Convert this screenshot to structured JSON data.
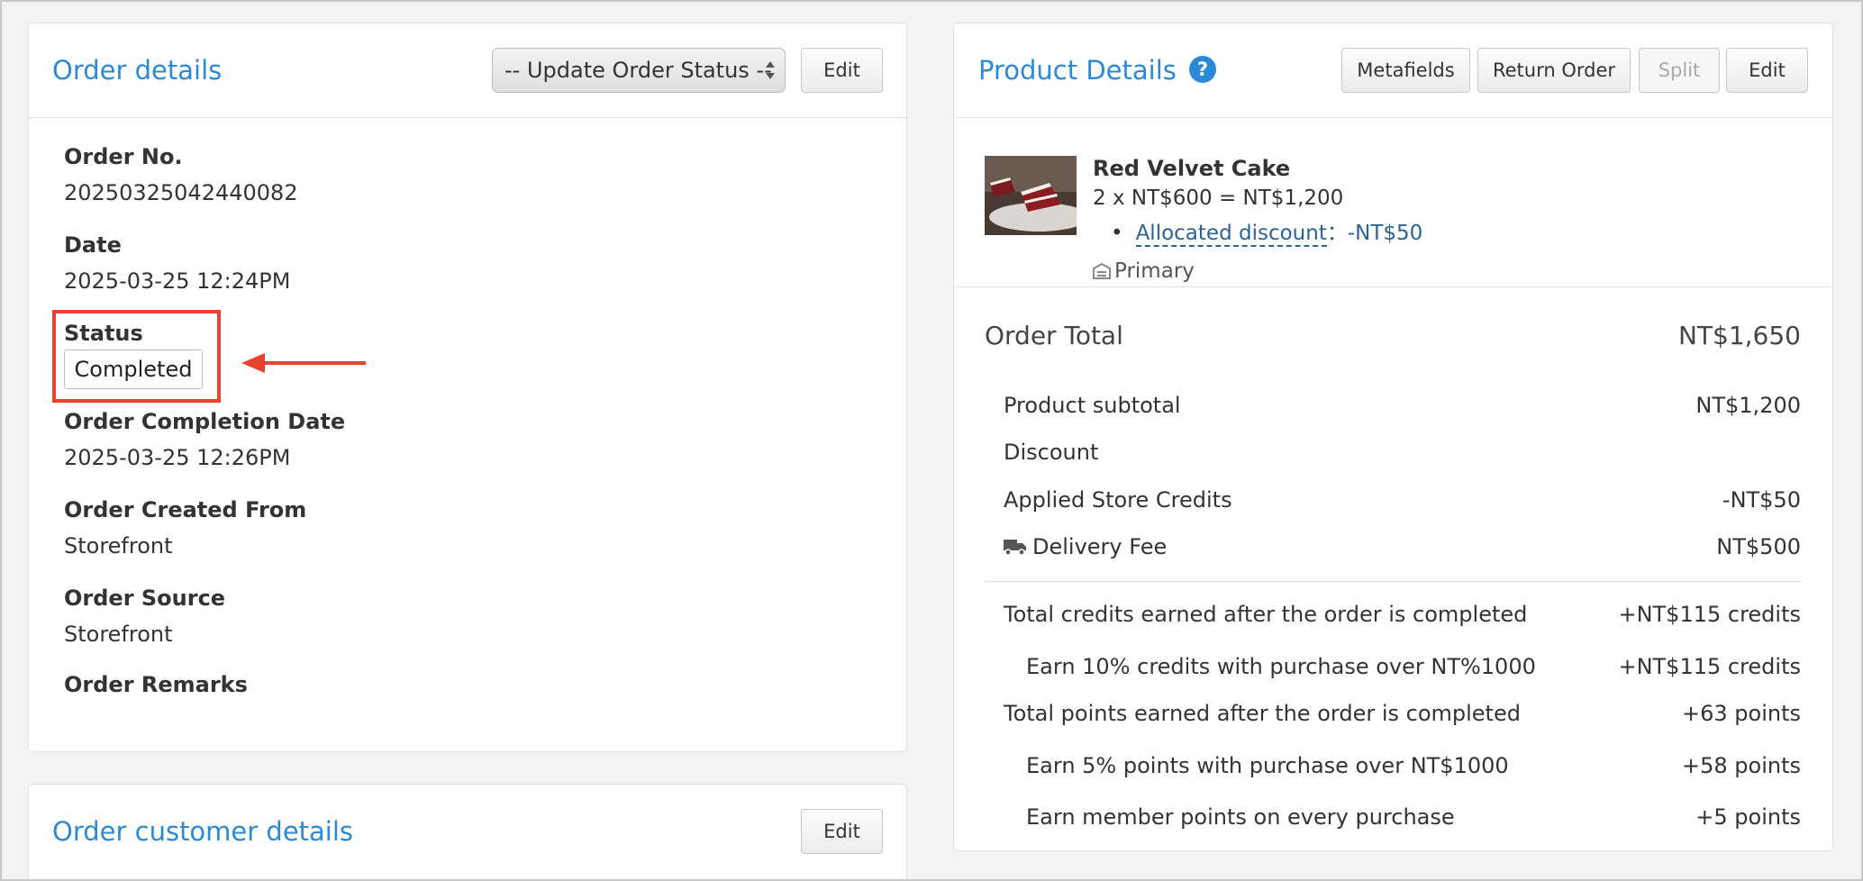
{
  "order_details": {
    "title": "Order details",
    "status_select": "-- Update Order Status --",
    "edit_label": "Edit",
    "fields": {
      "order_no_label": "Order No.",
      "order_no_value": "20250325042440082",
      "date_label": "Date",
      "date_value": "2025-03-25 12:24PM",
      "status_label": "Status",
      "status_value": "Completed",
      "completion_label": "Order Completion Date",
      "completion_value": "2025-03-25 12:26PM",
      "created_from_label": "Order Created From",
      "created_from_value": "Storefront",
      "source_label": "Order Source",
      "source_value": "Storefront",
      "remarks_label": "Order Remarks"
    }
  },
  "customer_details": {
    "title": "Order customer details",
    "edit_label": "Edit"
  },
  "product_details": {
    "title": "Product Details",
    "help_icon": "question-circle-icon",
    "buttons": {
      "metafields": "Metafields",
      "return_order": "Return Order",
      "split": "Split",
      "edit": "Edit"
    },
    "item": {
      "name": "Red Velvet Cake",
      "price_line": "2 x NT$600 = NT$1,200",
      "discount_link": "Allocated discount",
      "discount_amount": "：-NT$50",
      "location": "Primary"
    },
    "order_total_label": "Order Total",
    "order_total_value": "NT$1,650",
    "summary": {
      "subtotal_label": "Product subtotal",
      "subtotal_value": "NT$1,200",
      "discount_label": "Discount",
      "credits_label": "Applied Store Credits",
      "credits_value": "-NT$50",
      "delivery_label": "Delivery Fee",
      "delivery_value": "NT$500"
    },
    "rewards": {
      "total_credits_label": "Total credits earned after the order is completed",
      "total_credits_value": "+NT$115 credits",
      "credits_rule_label": "Earn 10% credits with purchase over NT%1000",
      "credits_rule_value": "+NT$115 credits",
      "total_points_label": "Total points earned after the order is completed",
      "total_points_value": "+63 points",
      "points_rule_label": "Earn 5% points with purchase over NT$1000",
      "points_rule_value": "+58 points",
      "member_points_label": "Earn member points on every purchase",
      "member_points_value": "+5 points"
    }
  },
  "colors": {
    "accent": "#2b8ad8",
    "highlight": "#e8432f",
    "discount_link": "#2a6496"
  }
}
